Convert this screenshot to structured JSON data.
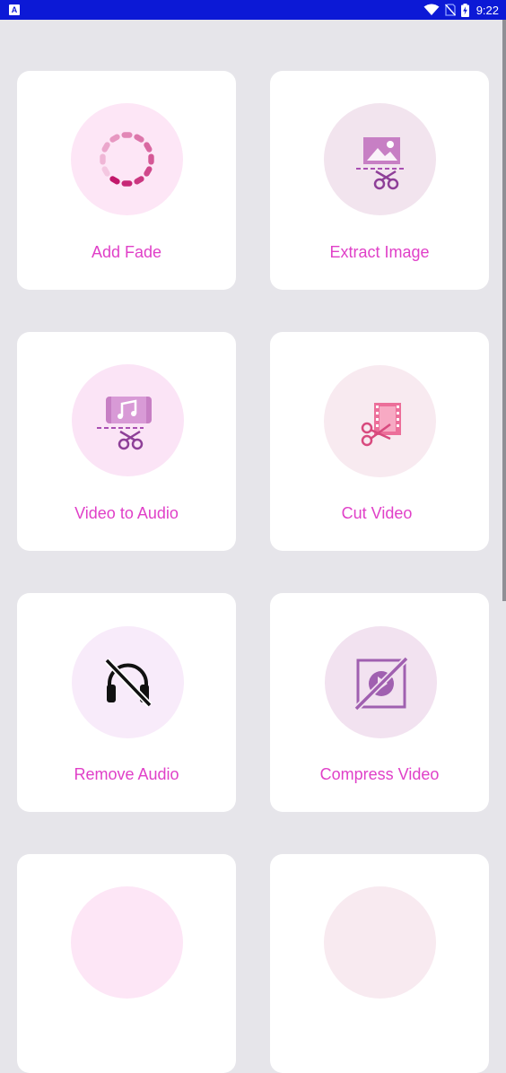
{
  "status_bar": {
    "time": "9:22",
    "left_icon_letter": "A",
    "icons": [
      "notification-a-icon",
      "wifi-icon",
      "no-sim-icon",
      "battery-charging-icon"
    ]
  },
  "tools": [
    {
      "label": "Add Fade",
      "icon": "loading-spinner-icon",
      "circle_color": "#fde6f6"
    },
    {
      "label": "Extract Image",
      "icon": "image-scissors-icon",
      "circle_color": "#f2e4ee"
    },
    {
      "label": "Video to Audio",
      "icon": "music-scissors-icon",
      "circle_color": "#fbe4f6"
    },
    {
      "label": "Cut Video",
      "icon": "film-scissors-icon",
      "circle_color": "#f8eaf0"
    },
    {
      "label": "Remove Audio",
      "icon": "headphones-off-icon",
      "circle_color": "#f8ebfa"
    },
    {
      "label": "Compress Video",
      "icon": "compress-video-icon",
      "circle_color": "#f2e2f0"
    }
  ],
  "colors": {
    "accent": "#e040c8",
    "status_bar": "#0c19d6",
    "background": "#e6e5ea",
    "card": "#ffffff"
  }
}
